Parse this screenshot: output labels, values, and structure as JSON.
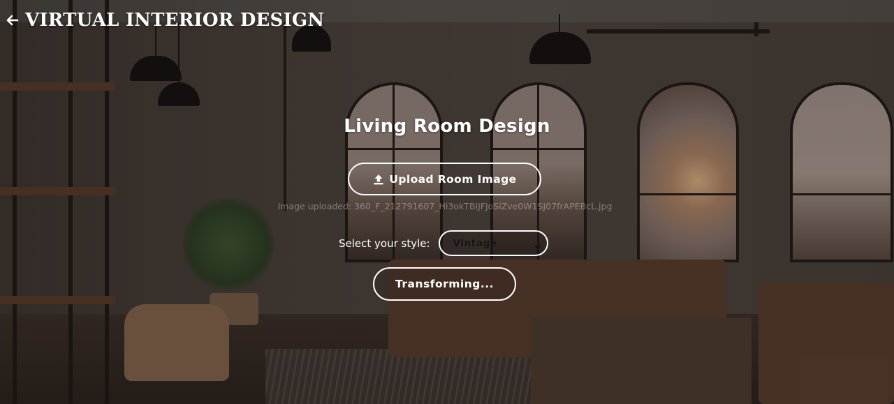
{
  "header": {
    "back_icon": "arrow-left-icon",
    "title": "VIRTUAL INTERIOR DESIGN"
  },
  "main": {
    "title": "Living Room Design",
    "upload_button": {
      "icon": "upload-icon",
      "label": "Upload Room Image"
    },
    "upload_status": "Image uploaded: 360_F_212791607_Hi3okTBIJFJoSiZve0W1SJ07frAPEBcL.jpg",
    "style_select": {
      "label": "Select your style:",
      "selected": "Vintage"
    },
    "transform_button": {
      "label": "Transforming..."
    }
  },
  "colors": {
    "text": "#ffffff",
    "button_border": "#ffffff",
    "status_text": "#e6e1dc"
  }
}
